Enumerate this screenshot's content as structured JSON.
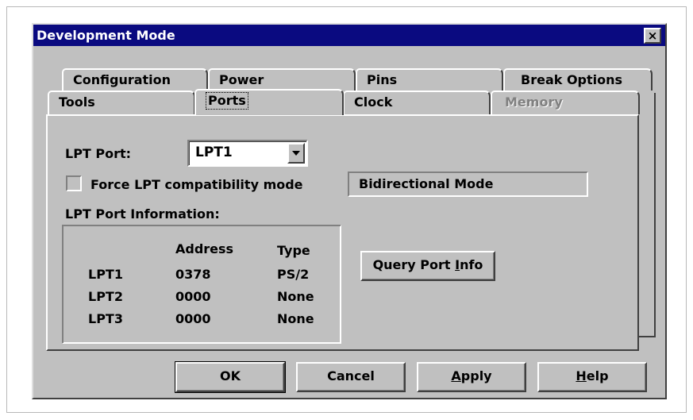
{
  "window": {
    "title": "Development Mode",
    "close_label": "×"
  },
  "tabs": {
    "back_row": [
      "Configuration",
      "Power",
      "Pins",
      "Break Options"
    ],
    "front_row": [
      "Tools",
      "Ports",
      "Clock",
      "Memory"
    ],
    "active": "Ports",
    "disabled": [
      "Memory"
    ]
  },
  "ports": {
    "lpt_port_label": "LPT Port:",
    "lpt_port_value": "LPT1",
    "force_checkbox_label": "Force LPT compatibility mode",
    "force_checked": false,
    "mode_text": "Bidirectional Mode",
    "info_group_label": "LPT Port Information:",
    "columns": [
      "",
      "Address",
      "Type"
    ],
    "rows": [
      [
        "LPT1",
        "0378",
        "PS/2"
      ],
      [
        "LPT2",
        "0000",
        "None"
      ],
      [
        "LPT3",
        "0000",
        "None"
      ]
    ],
    "query_prefix": "Query Port ",
    "query_mnemonic": "I",
    "query_suffix": "nfo"
  },
  "buttons": {
    "ok": "OK",
    "cancel": "Cancel",
    "apply_mnemonic": "A",
    "apply_rest": "pply",
    "help_mnemonic": "H",
    "help_rest": "elp"
  },
  "icons": {
    "dropdown": "chevron-down-icon",
    "close": "close-icon"
  }
}
